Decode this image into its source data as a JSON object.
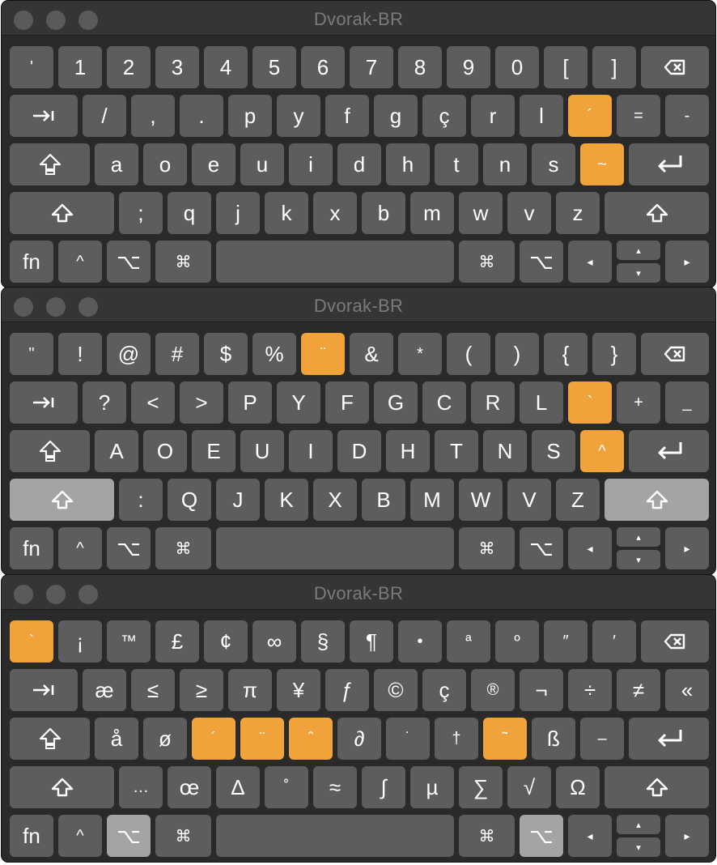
{
  "colors": {
    "window_bg": "#2a2a2b",
    "key_bg": "#5d5d5f",
    "dead_key": "#f0a23b",
    "pressed_key": "#a4a4a6",
    "title_text": "#7b7b7d"
  },
  "windows": [
    {
      "title": "Dvorak-BR",
      "rows": [
        [
          "'",
          "1",
          "2",
          "3",
          "4",
          "5",
          "6",
          "7",
          "8",
          "9",
          "0",
          "[",
          "]"
        ],
        [
          "/",
          ",",
          ".",
          "p",
          "y",
          "f",
          "g",
          "ç",
          "r",
          "l",
          "´",
          "=",
          "-"
        ],
        [
          "a",
          "o",
          "e",
          "u",
          "i",
          "d",
          "h",
          "t",
          "n",
          "s",
          "~"
        ],
        [
          ";",
          "q",
          "j",
          "k",
          "x",
          "b",
          "m",
          "w",
          "v",
          "z"
        ]
      ],
      "dead_keys": [
        "´",
        "~"
      ],
      "pressed": []
    },
    {
      "title": "Dvorak-BR",
      "rows": [
        [
          "\"",
          "!",
          "@",
          "#",
          "$",
          "%",
          "¨",
          "&",
          "*",
          "(",
          ")",
          "{",
          "}"
        ],
        [
          "?",
          "<",
          ">",
          "P",
          "Y",
          "F",
          "G",
          "C",
          "R",
          "L",
          "`",
          "+",
          "_"
        ],
        [
          "A",
          "O",
          "E",
          "U",
          "I",
          "D",
          "H",
          "T",
          "N",
          "S",
          "^"
        ],
        [
          ":",
          "Q",
          "J",
          "K",
          "X",
          "B",
          "M",
          "W",
          "V",
          "Z"
        ]
      ],
      "dead_keys": [
        "¨",
        "`",
        "^"
      ],
      "pressed": [
        "shift-left",
        "shift-right"
      ]
    },
    {
      "title": "Dvorak-BR",
      "rows": [
        [
          "`",
          "¡",
          "™",
          "£",
          "¢",
          "∞",
          "§",
          "¶",
          "•",
          "ª",
          "º",
          "″",
          "′"
        ],
        [
          "æ",
          "≤",
          "≥",
          "π",
          "¥",
          "ƒ",
          "©",
          "ç",
          "®",
          "¬",
          "÷",
          "≠",
          "«"
        ],
        [
          "å",
          "ø",
          "´",
          "¨",
          "ˆ",
          "∂",
          "˙",
          "†",
          "˜",
          "ß",
          "–"
        ],
        [
          "…",
          "œ",
          "∆",
          "˚",
          "≈",
          "∫",
          "µ",
          "∑",
          "√",
          "Ω"
        ]
      ],
      "dead_keys": [
        "`",
        "´",
        "¨",
        "ˆ",
        "˜"
      ],
      "pressed": [
        "option-left",
        "option-right"
      ]
    }
  ],
  "modifiers": {
    "fn": "fn",
    "control": "^",
    "option": "⌥",
    "command": "⌘",
    "arrow_left": "◂",
    "arrow_right": "▸",
    "arrow_up": "▴",
    "arrow_down": "▾"
  },
  "icons": {
    "backspace": "delete-icon",
    "tab": "tab-icon",
    "caps_lock": "caps-lock-icon",
    "shift": "shift-icon",
    "return": "return-icon"
  }
}
